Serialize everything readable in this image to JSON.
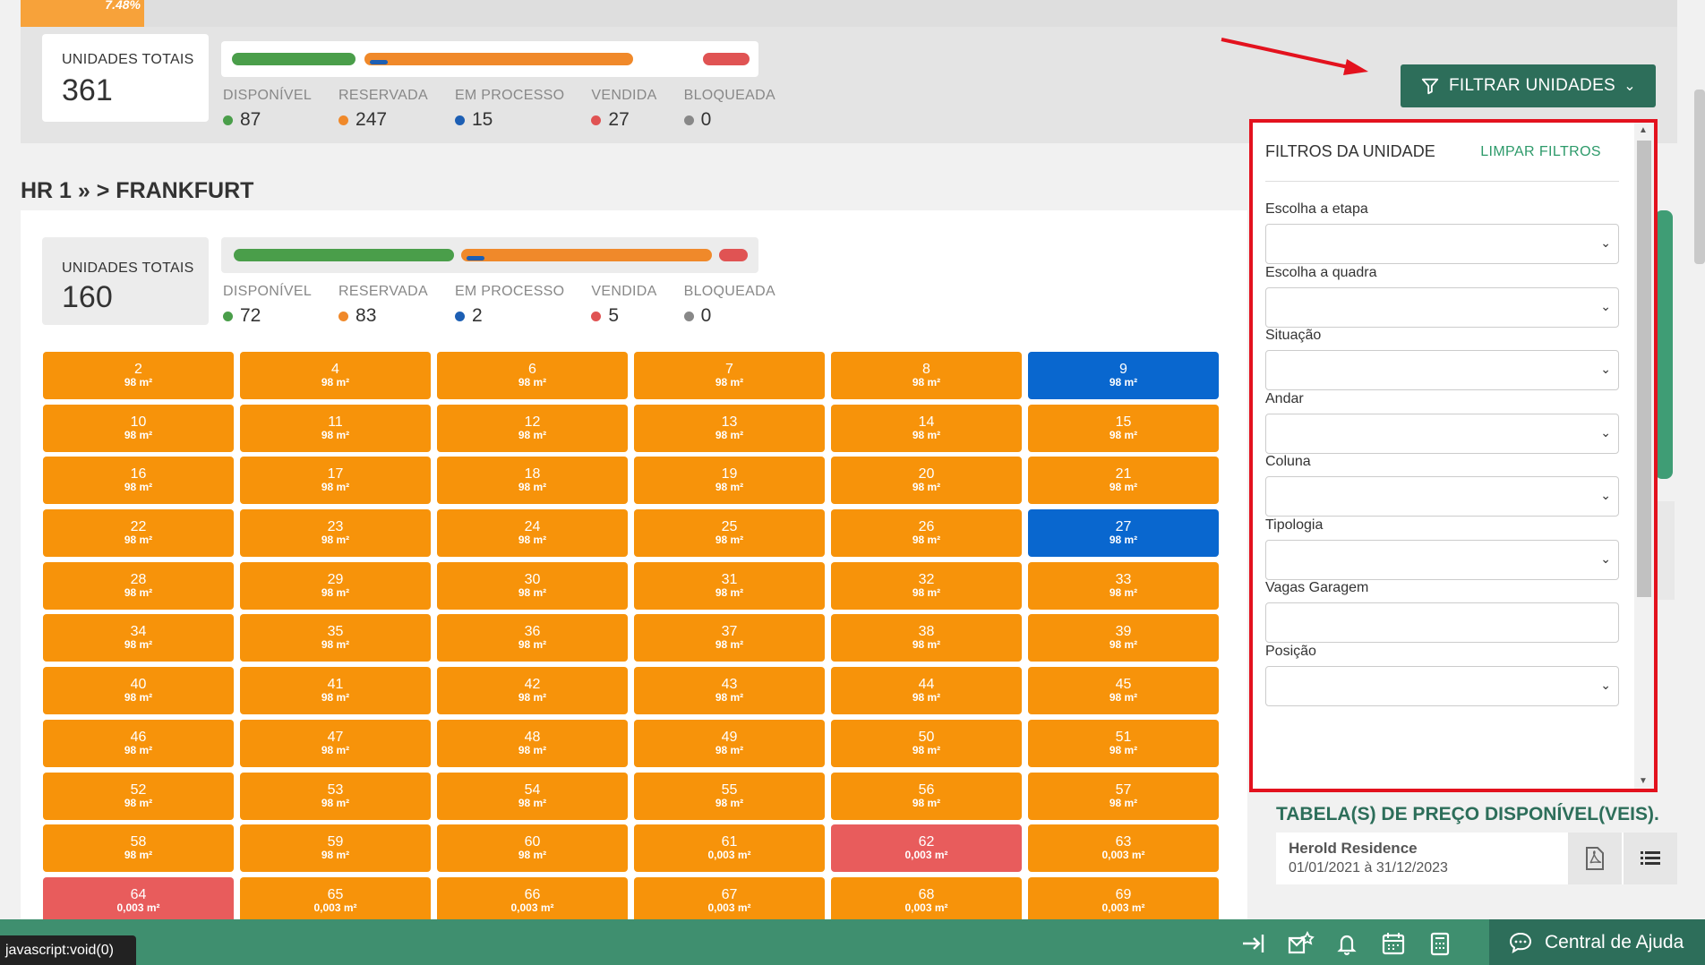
{
  "top_progress": {
    "label": "7.48%",
    "fraction": 0.0748
  },
  "summary_all": {
    "total_label": "UNIDADES TOTAIS",
    "total_value": "361",
    "legend": [
      {
        "label": "DISPONÍVEL",
        "value": "87",
        "color": "#4a9e4a"
      },
      {
        "label": "RESERVADA",
        "value": "247",
        "color": "#f0892a"
      },
      {
        "label": "EM PROCESSO",
        "value": "15",
        "color": "#1d5fb4"
      },
      {
        "label": "VENDIDA",
        "value": "27",
        "color": "#e05353"
      },
      {
        "label": "BLOQUEADA",
        "value": "0",
        "color": "#888888"
      }
    ]
  },
  "section": {
    "title": "HR 1 » > FRANKFURT"
  },
  "summary_section": {
    "total_label": "UNIDADES TOTAIS",
    "total_value": "160",
    "legend": [
      {
        "label": "DISPONÍVEL",
        "value": "72",
        "color": "#4a9e4a"
      },
      {
        "label": "RESERVADA",
        "value": "83",
        "color": "#f0892a"
      },
      {
        "label": "EM PROCESSO",
        "value": "2",
        "color": "#1d5fb4"
      },
      {
        "label": "VENDIDA",
        "value": "5",
        "color": "#e05353"
      },
      {
        "label": "BLOQUEADA",
        "value": "0",
        "color": "#888888"
      }
    ]
  },
  "units": [
    {
      "n": "2",
      "a": "98 m²",
      "s": "orange"
    },
    {
      "n": "4",
      "a": "98 m²",
      "s": "orange"
    },
    {
      "n": "6",
      "a": "98 m²",
      "s": "orange"
    },
    {
      "n": "7",
      "a": "98 m²",
      "s": "orange"
    },
    {
      "n": "8",
      "a": "98 m²",
      "s": "orange"
    },
    {
      "n": "9",
      "a": "98 m²",
      "s": "blue"
    },
    {
      "n": "10",
      "a": "98 m²",
      "s": "orange"
    },
    {
      "n": "11",
      "a": "98 m²",
      "s": "orange"
    },
    {
      "n": "12",
      "a": "98 m²",
      "s": "orange"
    },
    {
      "n": "13",
      "a": "98 m²",
      "s": "orange"
    },
    {
      "n": "14",
      "a": "98 m²",
      "s": "orange"
    },
    {
      "n": "15",
      "a": "98 m²",
      "s": "orange"
    },
    {
      "n": "16",
      "a": "98 m²",
      "s": "orange"
    },
    {
      "n": "17",
      "a": "98 m²",
      "s": "orange"
    },
    {
      "n": "18",
      "a": "98 m²",
      "s": "orange"
    },
    {
      "n": "19",
      "a": "98 m²",
      "s": "orange"
    },
    {
      "n": "20",
      "a": "98 m²",
      "s": "orange"
    },
    {
      "n": "21",
      "a": "98 m²",
      "s": "orange"
    },
    {
      "n": "22",
      "a": "98 m²",
      "s": "orange"
    },
    {
      "n": "23",
      "a": "98 m²",
      "s": "orange"
    },
    {
      "n": "24",
      "a": "98 m²",
      "s": "orange"
    },
    {
      "n": "25",
      "a": "98 m²",
      "s": "orange"
    },
    {
      "n": "26",
      "a": "98 m²",
      "s": "orange"
    },
    {
      "n": "27",
      "a": "98 m²",
      "s": "blue"
    },
    {
      "n": "28",
      "a": "98 m²",
      "s": "orange"
    },
    {
      "n": "29",
      "a": "98 m²",
      "s": "orange"
    },
    {
      "n": "30",
      "a": "98 m²",
      "s": "orange"
    },
    {
      "n": "31",
      "a": "98 m²",
      "s": "orange"
    },
    {
      "n": "32",
      "a": "98 m²",
      "s": "orange"
    },
    {
      "n": "33",
      "a": "98 m²",
      "s": "orange"
    },
    {
      "n": "34",
      "a": "98 m²",
      "s": "orange"
    },
    {
      "n": "35",
      "a": "98 m²",
      "s": "orange"
    },
    {
      "n": "36",
      "a": "98 m²",
      "s": "orange"
    },
    {
      "n": "37",
      "a": "98 m²",
      "s": "orange"
    },
    {
      "n": "38",
      "a": "98 m²",
      "s": "orange"
    },
    {
      "n": "39",
      "a": "98 m²",
      "s": "orange"
    },
    {
      "n": "40",
      "a": "98 m²",
      "s": "orange"
    },
    {
      "n": "41",
      "a": "98 m²",
      "s": "orange"
    },
    {
      "n": "42",
      "a": "98 m²",
      "s": "orange"
    },
    {
      "n": "43",
      "a": "98 m²",
      "s": "orange"
    },
    {
      "n": "44",
      "a": "98 m²",
      "s": "orange"
    },
    {
      "n": "45",
      "a": "98 m²",
      "s": "orange"
    },
    {
      "n": "46",
      "a": "98 m²",
      "s": "orange"
    },
    {
      "n": "47",
      "a": "98 m²",
      "s": "orange"
    },
    {
      "n": "48",
      "a": "98 m²",
      "s": "orange"
    },
    {
      "n": "49",
      "a": "98 m²",
      "s": "orange"
    },
    {
      "n": "50",
      "a": "98 m²",
      "s": "orange"
    },
    {
      "n": "51",
      "a": "98 m²",
      "s": "orange"
    },
    {
      "n": "52",
      "a": "98 m²",
      "s": "orange"
    },
    {
      "n": "53",
      "a": "98 m²",
      "s": "orange"
    },
    {
      "n": "54",
      "a": "98 m²",
      "s": "orange"
    },
    {
      "n": "55",
      "a": "98 m²",
      "s": "orange"
    },
    {
      "n": "56",
      "a": "98 m²",
      "s": "orange"
    },
    {
      "n": "57",
      "a": "98 m²",
      "s": "orange"
    },
    {
      "n": "58",
      "a": "98 m²",
      "s": "orange"
    },
    {
      "n": "59",
      "a": "98 m²",
      "s": "orange"
    },
    {
      "n": "60",
      "a": "98 m²",
      "s": "orange"
    },
    {
      "n": "61",
      "a": "0,003 m²",
      "s": "orange"
    },
    {
      "n": "62",
      "a": "0,003 m²",
      "s": "red"
    },
    {
      "n": "63",
      "a": "0,003 m²",
      "s": "orange"
    },
    {
      "n": "64",
      "a": "0,003 m²",
      "s": "red"
    },
    {
      "n": "65",
      "a": "0,003 m²",
      "s": "orange"
    },
    {
      "n": "66",
      "a": "0,003 m²",
      "s": "orange"
    },
    {
      "n": "67",
      "a": "0,003 m²",
      "s": "orange"
    },
    {
      "n": "68",
      "a": "0,003 m²",
      "s": "orange"
    },
    {
      "n": "69",
      "a": "0,003 m²",
      "s": "orange"
    }
  ],
  "filter_button": {
    "label": "FILTRAR UNIDADES",
    "icon": "filter-icon"
  },
  "filter_panel": {
    "title": "FILTROS DA UNIDADE",
    "clear_label": "LIMPAR FILTROS",
    "fields": [
      {
        "label": "Escolha a etapa",
        "type": "select",
        "value": ""
      },
      {
        "label": "Escolha a quadra",
        "type": "select",
        "value": ""
      },
      {
        "label": "Situação",
        "type": "select",
        "value": ""
      },
      {
        "label": "Andar",
        "type": "select",
        "value": ""
      },
      {
        "label": "Coluna",
        "type": "select",
        "value": ""
      },
      {
        "label": "Tipologia",
        "type": "select",
        "value": ""
      },
      {
        "label": "Vagas Garagem",
        "type": "input",
        "value": ""
      },
      {
        "label": "Posição",
        "type": "select",
        "value": ""
      }
    ]
  },
  "price_tables": {
    "title": "TABELA(S) DE PREÇO DISPONÍVEL(VEIS).",
    "rows": [
      {
        "name": "Herold Residence",
        "dates": "01/01/2021 à 31/12/2023"
      }
    ]
  },
  "status_bar": {
    "url": "javascript:void(0)"
  },
  "bottom_bar": {
    "icons": [
      "logout-arrow-icon",
      "mail-star-icon",
      "bell-icon",
      "calendar-icon",
      "calculator-icon"
    ],
    "help_label": "Central de Ajuda"
  }
}
